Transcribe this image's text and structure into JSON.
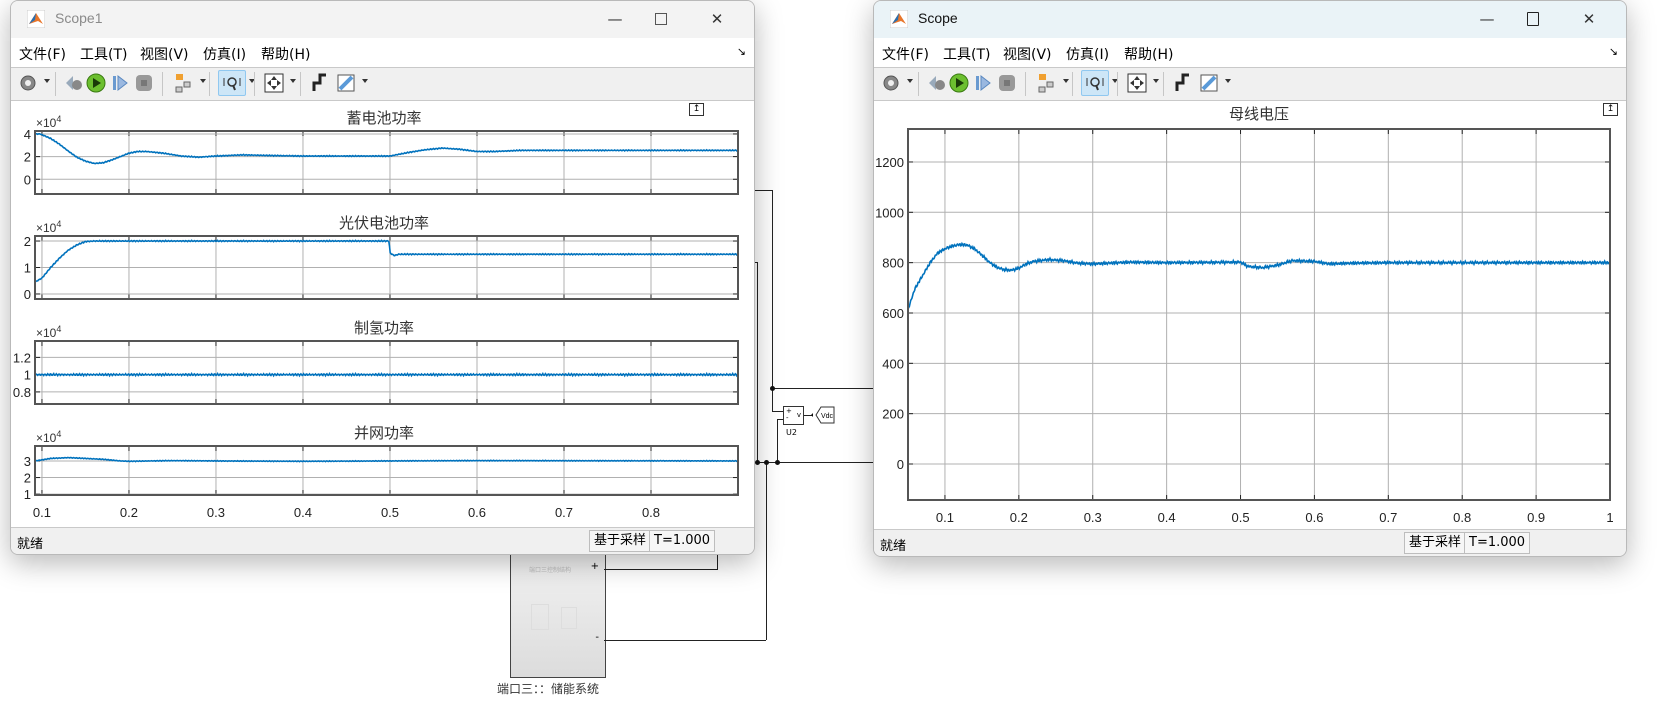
{
  "scope1": {
    "title": "Scope1",
    "menu": [
      "文件(F)",
      "工具(T)",
      "视图(V)",
      "仿真(I)",
      "帮助(H)"
    ],
    "status": "就绪",
    "sample_mode": "基于采样",
    "time": "T=1.000"
  },
  "scope": {
    "title": "Scope",
    "menu": [
      "文件(F)",
      "工具(T)",
      "视图(V)",
      "仿真(I)",
      "帮助(H)"
    ],
    "status": "就绪",
    "sample_mode": "基于采样",
    "time": "T=1.000"
  },
  "toolbar_icons": [
    "gear-icon",
    "step-back-icon",
    "run-icon",
    "step-forward-icon",
    "stop-icon",
    "signal-selector-icon",
    "zoom-axes-icon",
    "autoscale-icon",
    "trigger-icon",
    "measure-icon"
  ],
  "colors": {
    "trace": "#0072bd",
    "grid": "#b0b0b0",
    "axis": "#555555"
  },
  "diagram": {
    "block_label": "端口三：：储能系统",
    "block_inner_title": "端口三控制结构",
    "voltmeter_label": "U2",
    "voltmeter_port": "v",
    "goto_tag": "Vdc",
    "plus_port": "+",
    "minus_port": "-"
  },
  "chart_data": [
    {
      "type": "line",
      "window": "scope1",
      "title": "蓄电池功率",
      "scale_label": "×10",
      "scale_exp": "4",
      "xlim": [
        0.092,
        0.9
      ],
      "ylim": [
        -1.3,
        4.26
      ],
      "xticks": [
        0.1,
        0.2,
        0.3,
        0.4,
        0.5,
        0.6,
        0.7,
        0.8
      ],
      "yticks": [
        0,
        2,
        4
      ],
      "ytick_labels": [
        "0",
        "2",
        "4"
      ],
      "show_xtick_labels": false,
      "grid": true,
      "ripple": 0.03,
      "points": [
        [
          0.092,
          4.0
        ],
        [
          0.098,
          4.0
        ],
        [
          0.11,
          3.6
        ],
        [
          0.12,
          3.1
        ],
        [
          0.13,
          2.5
        ],
        [
          0.14,
          1.95
        ],
        [
          0.15,
          1.6
        ],
        [
          0.16,
          1.4
        ],
        [
          0.17,
          1.45
        ],
        [
          0.18,
          1.7
        ],
        [
          0.19,
          2.0
        ],
        [
          0.2,
          2.3
        ],
        [
          0.21,
          2.45
        ],
        [
          0.22,
          2.45
        ],
        [
          0.24,
          2.3
        ],
        [
          0.26,
          2.05
        ],
        [
          0.28,
          1.95
        ],
        [
          0.3,
          2.05
        ],
        [
          0.33,
          2.15
        ],
        [
          0.36,
          2.1
        ],
        [
          0.4,
          2.05
        ],
        [
          0.5,
          2.05
        ],
        [
          0.52,
          2.35
        ],
        [
          0.54,
          2.6
        ],
        [
          0.56,
          2.75
        ],
        [
          0.58,
          2.65
        ],
        [
          0.6,
          2.45
        ],
        [
          0.62,
          2.45
        ],
        [
          0.65,
          2.55
        ],
        [
          0.7,
          2.55
        ],
        [
          0.9,
          2.55
        ]
      ]
    },
    {
      "type": "line",
      "window": "scope1",
      "title": "光伏电池功率",
      "scale_label": "×10",
      "scale_exp": "4",
      "xlim": [
        0.092,
        0.9
      ],
      "ylim": [
        -0.19,
        2.19
      ],
      "xticks": [
        0.1,
        0.2,
        0.3,
        0.4,
        0.5,
        0.6,
        0.7,
        0.8
      ],
      "yticks": [
        0,
        1,
        2
      ],
      "ytick_labels": [
        "0",
        "1",
        "2"
      ],
      "show_xtick_labels": false,
      "grid": true,
      "ripple": 0.015,
      "points": [
        [
          0.092,
          0.45
        ],
        [
          0.1,
          0.6
        ],
        [
          0.11,
          1.0
        ],
        [
          0.12,
          1.35
        ],
        [
          0.13,
          1.65
        ],
        [
          0.14,
          1.85
        ],
        [
          0.15,
          1.98
        ],
        [
          0.16,
          2.0
        ],
        [
          0.499,
          2.0
        ],
        [
          0.5,
          1.55
        ],
        [
          0.505,
          1.45
        ],
        [
          0.51,
          1.5
        ],
        [
          0.9,
          1.5
        ]
      ]
    },
    {
      "type": "line",
      "window": "scope1",
      "title": "制氢功率",
      "scale_label": "×10",
      "scale_exp": "4",
      "xlim": [
        0.092,
        0.9
      ],
      "ylim": [
        0.66,
        1.39
      ],
      "xticks": [
        0.1,
        0.2,
        0.3,
        0.4,
        0.5,
        0.6,
        0.7,
        0.8
      ],
      "yticks": [
        0.8,
        1,
        1.2
      ],
      "ytick_labels": [
        "0.8",
        "1",
        "1.2"
      ],
      "show_xtick_labels": false,
      "grid": true,
      "ripple": 0.008,
      "points": [
        [
          0.092,
          1.0
        ],
        [
          0.9,
          1.0
        ]
      ]
    },
    {
      "type": "line",
      "window": "scope1",
      "title": "并网功率",
      "scale_label": "×10",
      "scale_exp": "4",
      "xlim": [
        0.092,
        0.9
      ],
      "ylim": [
        0.95,
        3.9
      ],
      "xticks": [
        0.1,
        0.2,
        0.3,
        0.4,
        0.5,
        0.6,
        0.7,
        0.8
      ],
      "xtick_labels": [
        "0.1",
        "0.2",
        "0.3",
        "0.4",
        "0.5",
        "0.6",
        "0.7",
        "0.8"
      ],
      "yticks": [
        1,
        2,
        3
      ],
      "ytick_labels": [
        "1",
        "2",
        "3"
      ],
      "show_xtick_labels": true,
      "grid": true,
      "ripple": 0.015,
      "points": [
        [
          0.092,
          3.0
        ],
        [
          0.11,
          3.15
        ],
        [
          0.13,
          3.2
        ],
        [
          0.15,
          3.15
        ],
        [
          0.17,
          3.1
        ],
        [
          0.19,
          3.0
        ],
        [
          0.2,
          2.98
        ],
        [
          0.25,
          3.02
        ],
        [
          0.3,
          3.0
        ],
        [
          0.4,
          2.98
        ],
        [
          0.5,
          3.0
        ],
        [
          0.6,
          3.02
        ],
        [
          0.9,
          3.0
        ]
      ]
    },
    {
      "type": "line",
      "window": "scope",
      "title": "母线电压",
      "xlim": [
        0.05,
        1.0
      ],
      "ylim": [
        -143,
        1331
      ],
      "xticks": [
        0.1,
        0.2,
        0.3,
        0.4,
        0.5,
        0.6,
        0.7,
        0.8,
        0.9,
        1.0
      ],
      "xtick_labels": [
        "0.1",
        "0.2",
        "0.3",
        "0.4",
        "0.5",
        "0.6",
        "0.7",
        "0.8",
        "0.9",
        "1"
      ],
      "yticks": [
        0,
        200,
        400,
        600,
        800,
        1000,
        1200
      ],
      "ytick_labels": [
        "0",
        "200",
        "400",
        "600",
        "800",
        "1000",
        "1200"
      ],
      "show_xtick_labels": true,
      "grid": true,
      "ripple": 4,
      "points": [
        [
          0.05,
          610
        ],
        [
          0.055,
          660
        ],
        [
          0.06,
          700
        ],
        [
          0.07,
          750
        ],
        [
          0.08,
          800
        ],
        [
          0.09,
          838
        ],
        [
          0.1,
          855
        ],
        [
          0.11,
          866
        ],
        [
          0.12,
          872
        ],
        [
          0.13,
          870
        ],
        [
          0.14,
          855
        ],
        [
          0.15,
          830
        ],
        [
          0.16,
          802
        ],
        [
          0.17,
          782
        ],
        [
          0.18,
          772
        ],
        [
          0.19,
          770
        ],
        [
          0.2,
          778
        ],
        [
          0.21,
          795
        ],
        [
          0.22,
          805
        ],
        [
          0.24,
          812
        ],
        [
          0.26,
          808
        ],
        [
          0.28,
          798
        ],
        [
          0.3,
          795
        ],
        [
          0.35,
          802
        ],
        [
          0.4,
          800
        ],
        [
          0.5,
          802
        ],
        [
          0.51,
          785
        ],
        [
          0.53,
          780
        ],
        [
          0.55,
          790
        ],
        [
          0.57,
          808
        ],
        [
          0.6,
          805
        ],
        [
          0.62,
          795
        ],
        [
          0.65,
          798
        ],
        [
          0.7,
          800
        ],
        [
          1.0,
          800
        ]
      ]
    }
  ]
}
